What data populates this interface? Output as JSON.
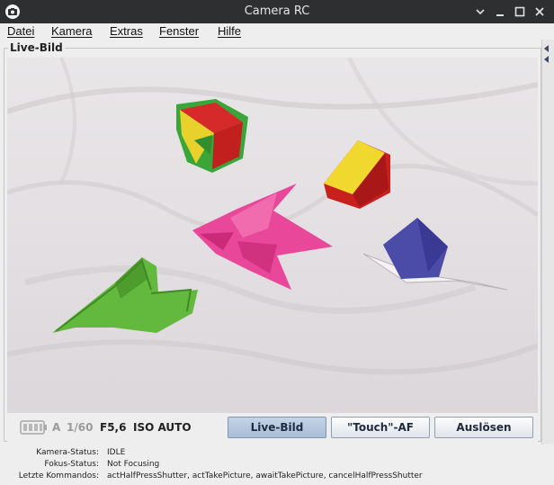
{
  "window": {
    "title": "Camera RC",
    "icon": "camera-icon",
    "controls": [
      "minimize-icon",
      "maximize-icon",
      "close-icon"
    ]
  },
  "menu": {
    "items": [
      {
        "label": "Datei"
      },
      {
        "label": "Kamera"
      },
      {
        "label": "Extras"
      },
      {
        "label": "Fenster"
      },
      {
        "label": "Hilfe"
      }
    ]
  },
  "live_panel": {
    "title": "Live-Bild"
  },
  "camera": {
    "battery_icon": "battery-icon",
    "mode": "A",
    "shutter": "1/60",
    "aperture": "F5,6",
    "iso": "ISO AUTO"
  },
  "buttons": {
    "live": "Live-Bild",
    "touch_af": "\"Touch\"-AF",
    "release": "Auslösen"
  },
  "status": {
    "camera_label": "Kamera-Status:",
    "camera_value": "IDLE",
    "focus_label": "Fokus-Status:",
    "focus_value": "Not Focusing",
    "commands_label": "Letzte Kommandos:",
    "commands_value": "actHalfPressShutter, actTakePicture, awaitTakePicture, cancelHalfPressShutter"
  },
  "colors": {
    "titlebar": "#2e2f30",
    "active_button": "#b6c8dd",
    "inactive_text": "#9a9a9a"
  }
}
